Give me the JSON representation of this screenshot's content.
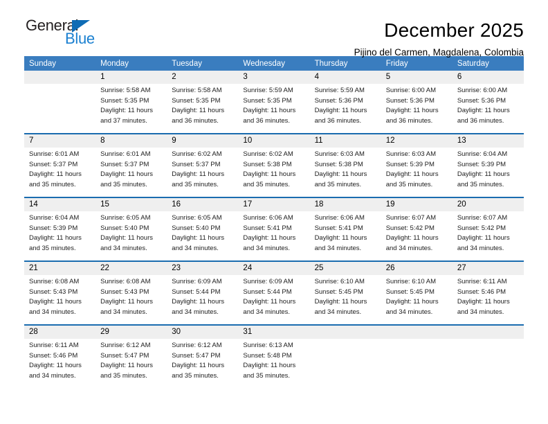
{
  "brand": {
    "name_top": "General",
    "name_bottom": "Blue",
    "triangle_icon": "triangle-icon",
    "accent_color": "#0f6cb5",
    "blue_text_color": "#1b80d0"
  },
  "header": {
    "title": "December 2025",
    "subtitle": "Pijino del Carmen, Magdalena, Colombia"
  },
  "theme": {
    "header_bg": "#3a7dbf",
    "row_divider": "#1a6caf",
    "daynum_bg": "#efefef",
    "text": "#000000"
  },
  "calendar": {
    "weekdays": [
      "Sunday",
      "Monday",
      "Tuesday",
      "Wednesday",
      "Thursday",
      "Friday",
      "Saturday"
    ],
    "weeks": [
      [
        {
          "day": ""
        },
        {
          "day": "1",
          "sunrise": "Sunrise: 5:58 AM",
          "sunset": "Sunset: 5:35 PM",
          "daylight1": "Daylight: 11 hours",
          "daylight2": "and 37 minutes."
        },
        {
          "day": "2",
          "sunrise": "Sunrise: 5:58 AM",
          "sunset": "Sunset: 5:35 PM",
          "daylight1": "Daylight: 11 hours",
          "daylight2": "and 36 minutes."
        },
        {
          "day": "3",
          "sunrise": "Sunrise: 5:59 AM",
          "sunset": "Sunset: 5:35 PM",
          "daylight1": "Daylight: 11 hours",
          "daylight2": "and 36 minutes."
        },
        {
          "day": "4",
          "sunrise": "Sunrise: 5:59 AM",
          "sunset": "Sunset: 5:36 PM",
          "daylight1": "Daylight: 11 hours",
          "daylight2": "and 36 minutes."
        },
        {
          "day": "5",
          "sunrise": "Sunrise: 6:00 AM",
          "sunset": "Sunset: 5:36 PM",
          "daylight1": "Daylight: 11 hours",
          "daylight2": "and 36 minutes."
        },
        {
          "day": "6",
          "sunrise": "Sunrise: 6:00 AM",
          "sunset": "Sunset: 5:36 PM",
          "daylight1": "Daylight: 11 hours",
          "daylight2": "and 36 minutes."
        }
      ],
      [
        {
          "day": "7",
          "sunrise": "Sunrise: 6:01 AM",
          "sunset": "Sunset: 5:37 PM",
          "daylight1": "Daylight: 11 hours",
          "daylight2": "and 35 minutes."
        },
        {
          "day": "8",
          "sunrise": "Sunrise: 6:01 AM",
          "sunset": "Sunset: 5:37 PM",
          "daylight1": "Daylight: 11 hours",
          "daylight2": "and 35 minutes."
        },
        {
          "day": "9",
          "sunrise": "Sunrise: 6:02 AM",
          "sunset": "Sunset: 5:37 PM",
          "daylight1": "Daylight: 11 hours",
          "daylight2": "and 35 minutes."
        },
        {
          "day": "10",
          "sunrise": "Sunrise: 6:02 AM",
          "sunset": "Sunset: 5:38 PM",
          "daylight1": "Daylight: 11 hours",
          "daylight2": "and 35 minutes."
        },
        {
          "day": "11",
          "sunrise": "Sunrise: 6:03 AM",
          "sunset": "Sunset: 5:38 PM",
          "daylight1": "Daylight: 11 hours",
          "daylight2": "and 35 minutes."
        },
        {
          "day": "12",
          "sunrise": "Sunrise: 6:03 AM",
          "sunset": "Sunset: 5:39 PM",
          "daylight1": "Daylight: 11 hours",
          "daylight2": "and 35 minutes."
        },
        {
          "day": "13",
          "sunrise": "Sunrise: 6:04 AM",
          "sunset": "Sunset: 5:39 PM",
          "daylight1": "Daylight: 11 hours",
          "daylight2": "and 35 minutes."
        }
      ],
      [
        {
          "day": "14",
          "sunrise": "Sunrise: 6:04 AM",
          "sunset": "Sunset: 5:39 PM",
          "daylight1": "Daylight: 11 hours",
          "daylight2": "and 35 minutes."
        },
        {
          "day": "15",
          "sunrise": "Sunrise: 6:05 AM",
          "sunset": "Sunset: 5:40 PM",
          "daylight1": "Daylight: 11 hours",
          "daylight2": "and 34 minutes."
        },
        {
          "day": "16",
          "sunrise": "Sunrise: 6:05 AM",
          "sunset": "Sunset: 5:40 PM",
          "daylight1": "Daylight: 11 hours",
          "daylight2": "and 34 minutes."
        },
        {
          "day": "17",
          "sunrise": "Sunrise: 6:06 AM",
          "sunset": "Sunset: 5:41 PM",
          "daylight1": "Daylight: 11 hours",
          "daylight2": "and 34 minutes."
        },
        {
          "day": "18",
          "sunrise": "Sunrise: 6:06 AM",
          "sunset": "Sunset: 5:41 PM",
          "daylight1": "Daylight: 11 hours",
          "daylight2": "and 34 minutes."
        },
        {
          "day": "19",
          "sunrise": "Sunrise: 6:07 AM",
          "sunset": "Sunset: 5:42 PM",
          "daylight1": "Daylight: 11 hours",
          "daylight2": "and 34 minutes."
        },
        {
          "day": "20",
          "sunrise": "Sunrise: 6:07 AM",
          "sunset": "Sunset: 5:42 PM",
          "daylight1": "Daylight: 11 hours",
          "daylight2": "and 34 minutes."
        }
      ],
      [
        {
          "day": "21",
          "sunrise": "Sunrise: 6:08 AM",
          "sunset": "Sunset: 5:43 PM",
          "daylight1": "Daylight: 11 hours",
          "daylight2": "and 34 minutes."
        },
        {
          "day": "22",
          "sunrise": "Sunrise: 6:08 AM",
          "sunset": "Sunset: 5:43 PM",
          "daylight1": "Daylight: 11 hours",
          "daylight2": "and 34 minutes."
        },
        {
          "day": "23",
          "sunrise": "Sunrise: 6:09 AM",
          "sunset": "Sunset: 5:44 PM",
          "daylight1": "Daylight: 11 hours",
          "daylight2": "and 34 minutes."
        },
        {
          "day": "24",
          "sunrise": "Sunrise: 6:09 AM",
          "sunset": "Sunset: 5:44 PM",
          "daylight1": "Daylight: 11 hours",
          "daylight2": "and 34 minutes."
        },
        {
          "day": "25",
          "sunrise": "Sunrise: 6:10 AM",
          "sunset": "Sunset: 5:45 PM",
          "daylight1": "Daylight: 11 hours",
          "daylight2": "and 34 minutes."
        },
        {
          "day": "26",
          "sunrise": "Sunrise: 6:10 AM",
          "sunset": "Sunset: 5:45 PM",
          "daylight1": "Daylight: 11 hours",
          "daylight2": "and 34 minutes."
        },
        {
          "day": "27",
          "sunrise": "Sunrise: 6:11 AM",
          "sunset": "Sunset: 5:46 PM",
          "daylight1": "Daylight: 11 hours",
          "daylight2": "and 34 minutes."
        }
      ],
      [
        {
          "day": "28",
          "sunrise": "Sunrise: 6:11 AM",
          "sunset": "Sunset: 5:46 PM",
          "daylight1": "Daylight: 11 hours",
          "daylight2": "and 34 minutes."
        },
        {
          "day": "29",
          "sunrise": "Sunrise: 6:12 AM",
          "sunset": "Sunset: 5:47 PM",
          "daylight1": "Daylight: 11 hours",
          "daylight2": "and 35 minutes."
        },
        {
          "day": "30",
          "sunrise": "Sunrise: 6:12 AM",
          "sunset": "Sunset: 5:47 PM",
          "daylight1": "Daylight: 11 hours",
          "daylight2": "and 35 minutes."
        },
        {
          "day": "31",
          "sunrise": "Sunrise: 6:13 AM",
          "sunset": "Sunset: 5:48 PM",
          "daylight1": "Daylight: 11 hours",
          "daylight2": "and 35 minutes."
        },
        {
          "day": ""
        },
        {
          "day": ""
        },
        {
          "day": ""
        }
      ]
    ]
  }
}
